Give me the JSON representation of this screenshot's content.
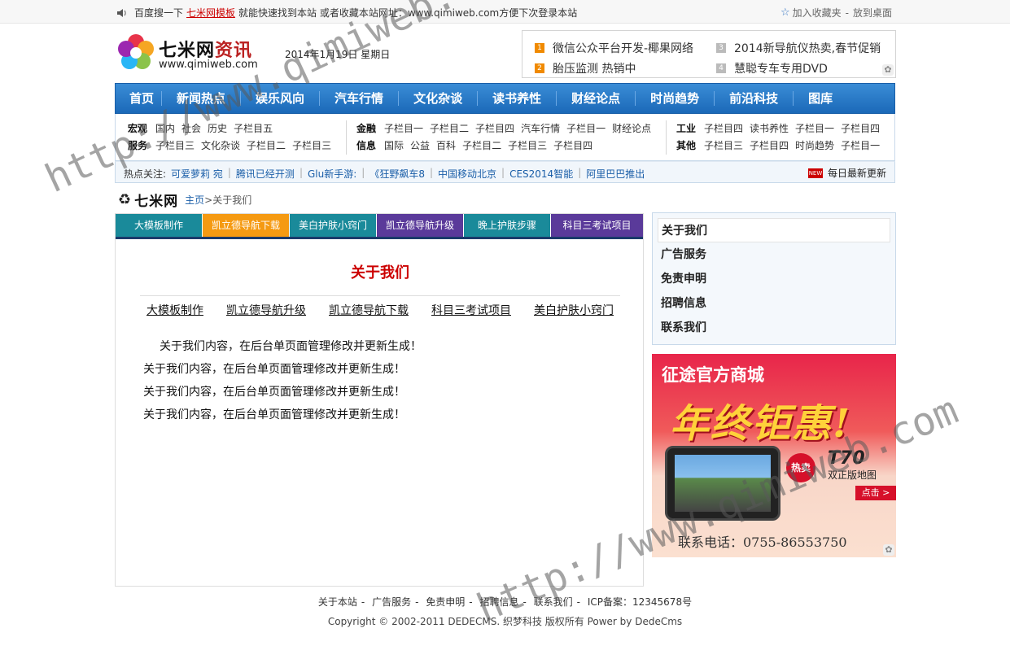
{
  "topbar": {
    "prefix": "百度搜一下",
    "highlight": "七米网模板",
    "suffix": "就能快速找到本站 或者收藏本站网址：www.qimiweb.com方便下次登录本站",
    "add_favorite": "加入收藏夹",
    "separator": "-",
    "put_desktop": "放到桌面"
  },
  "header": {
    "logo_name": "七米网",
    "logo_suffix": "资讯",
    "logo_domain": "www.qimiweb.com",
    "date": "2014年1月19日 星期日"
  },
  "hot_news": [
    {
      "num": "1",
      "text": "微信公众平台开发-椰果网络"
    },
    {
      "num": "2",
      "text": "胎压监测 热销中"
    },
    {
      "num": "3",
      "text": "2014新导航仪热卖,春节促销"
    },
    {
      "num": "4",
      "text": "慧聪专车专用DVD"
    }
  ],
  "nav": [
    "首页",
    "新闻热点",
    "娱乐风向",
    "汽车行情",
    "文化杂谈",
    "读书养性",
    "财经论点",
    "时尚趋势",
    "前沿科技",
    "图库"
  ],
  "subnav": {
    "group1": [
      {
        "title": "宏观",
        "items": [
          "国内",
          "社会",
          "历史",
          "子栏目五"
        ]
      },
      {
        "title": "服务",
        "items": [
          "子栏目三",
          "文化杂谈",
          "子栏目二",
          "子栏目三"
        ]
      }
    ],
    "group2": [
      {
        "title": "金融",
        "items": [
          "子栏目一",
          "子栏目二",
          "子栏目四",
          "汽车行情",
          "子栏目一",
          "财经论点"
        ]
      },
      {
        "title": "信息",
        "items": [
          "国际",
          "公益",
          "百科",
          "子栏目二",
          "子栏目三",
          "子栏目四"
        ]
      }
    ],
    "group3": [
      {
        "title": "工业",
        "items": [
          "子栏目四",
          "读书养性",
          "子栏目一",
          "子栏目四"
        ]
      },
      {
        "title": "其他",
        "items": [
          "子栏目三",
          "子栏目四",
          "时尚趋势",
          "子栏目一"
        ]
      }
    ]
  },
  "hotline": {
    "label": "热点关注:",
    "items": [
      "可爱萝莉 宛",
      "腾讯已经开测",
      "Glu新手游:",
      "《狂野飙车8",
      "中国移动北京",
      "CES2014智能",
      "阿里巴巴推出"
    ],
    "badge": "NEW",
    "daily": "每日最新更新"
  },
  "breadcrumb": {
    "site": "七米网",
    "home": "主页",
    "gt": ">",
    "current": "关于我们"
  },
  "tabs": [
    "大模板制作",
    "凯立德导航下载",
    "美白护肤小窍门",
    "凯立德导航升级",
    "晚上护肤步骤",
    "科目三考试项目"
  ],
  "page": {
    "title": "关于我们",
    "related": [
      "大模板制作",
      "凯立德导航升级",
      "凯立德导航下载",
      "科目三考试项目",
      "美白护肤小窍门"
    ],
    "paragraphs": [
      "关于我们内容，在后台单页面管理修改并更新生成！",
      "关于我们内容，在后台单页面管理修改并更新生成！",
      "关于我们内容，在后台单页面管理修改并更新生成！",
      "关于我们内容，在后台单页面管理修改并更新生成！"
    ]
  },
  "sidebar": [
    "关于我们",
    "广告服务",
    "免责申明",
    "招聘信息",
    "联系我们"
  ],
  "ad": {
    "brand": "征途官方商城",
    "slogan": "年终钜惠!",
    "hot": "热卖",
    "model": "T70",
    "sub": "双正版地图",
    "click": "点击 >",
    "phone": "联系电话：0755-86553750"
  },
  "footer": {
    "links": [
      "关于本站",
      "广告服务",
      "免责申明",
      "招聘信息",
      "联系我们"
    ],
    "icp": "ICP备案：12345678号",
    "copyright": "Copyright © 2002-2011 DEDECMS. 织梦科技 版权所有  Power by DedeCms"
  },
  "watermark": {
    "text1": "http://www.qimiweb.com",
    "text2": "http://www.qimiweb.com"
  },
  "colors": {
    "nav_blue": "#1b69b8",
    "title_red": "#c00000",
    "tab_teal": "#1a8a9a",
    "tab_orange": "#f59a12",
    "tab_purple": "#5a3a9a"
  }
}
